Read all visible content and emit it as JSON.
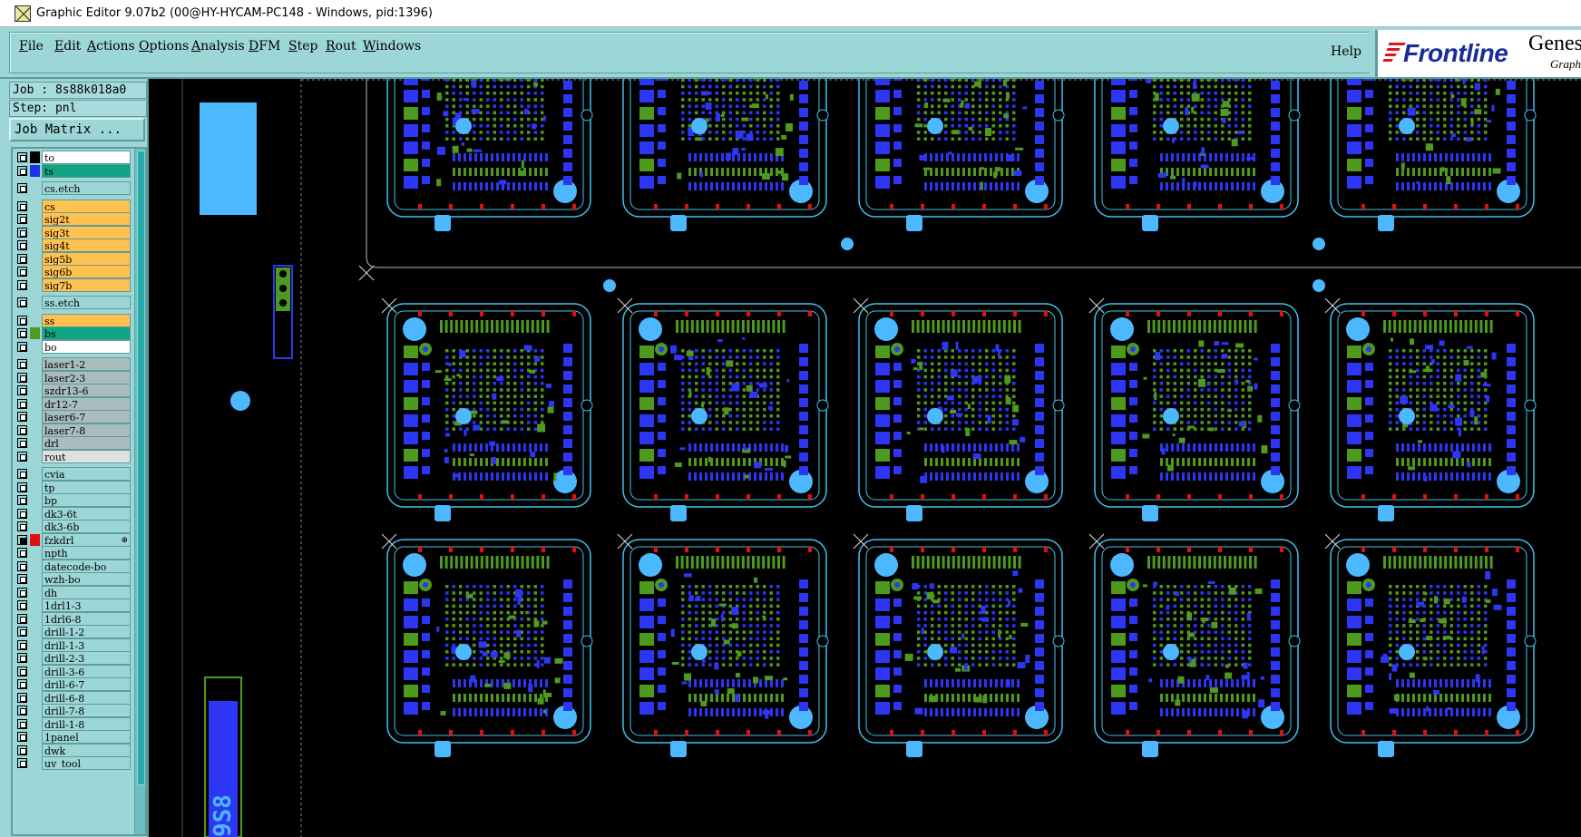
{
  "window": {
    "title": "Graphic Editor 9.07b2 (00@HY-HYCAM-PC148 - Windows, pid:1396)"
  },
  "menu": {
    "items": [
      "File",
      "Edit",
      "Actions",
      "Options",
      "Analysis",
      "DFM",
      "Step",
      "Rout",
      "Windows"
    ],
    "mnemonics": [
      "F",
      "E",
      "A",
      "O",
      "A",
      "D",
      "S",
      "R",
      "W"
    ],
    "help": "Help"
  },
  "logo": {
    "brand": "Frontline",
    "product": "Genes",
    "subtitle": "Graph"
  },
  "job": {
    "job_line": "Job : 8s88k018a0",
    "step_line": "Step: pnl",
    "matrix_button": "Job Matrix ..."
  },
  "colors": {
    "panel_bg": "#9dd6d6",
    "outline": "#3ec3f0",
    "copper": "#2d36f5",
    "mask": "#4d9a1e",
    "pad_light": "#4cb8ff",
    "route_red": "#e01010"
  },
  "layers": [
    {
      "name": "to",
      "bg": "#ffffff",
      "swatch": "#000000",
      "on": false,
      "group": 0
    },
    {
      "name": "ts",
      "bg": "#0fa583",
      "swatch": "#1f34e8",
      "on": false,
      "group": 0
    },
    {
      "name": "cs.etch",
      "bg": "#9dd6d6",
      "swatch": "",
      "on": false,
      "group": 1
    },
    {
      "name": "cs",
      "bg": "#ffc14f",
      "swatch": "",
      "on": false,
      "group": 2
    },
    {
      "name": "sig2t",
      "bg": "#ffc14f",
      "swatch": "",
      "on": false,
      "group": 2
    },
    {
      "name": "sig3t",
      "bg": "#ffc14f",
      "swatch": "",
      "on": false,
      "group": 2
    },
    {
      "name": "sig4t",
      "bg": "#ffc14f",
      "swatch": "",
      "on": false,
      "group": 2
    },
    {
      "name": "sig5b",
      "bg": "#ffc14f",
      "swatch": "",
      "on": false,
      "group": 2
    },
    {
      "name": "sig6b",
      "bg": "#ffc14f",
      "swatch": "",
      "on": false,
      "group": 2
    },
    {
      "name": "sig7b",
      "bg": "#ffc14f",
      "swatch": "",
      "on": false,
      "group": 2
    },
    {
      "name": "ss.etch",
      "bg": "#9dd6d6",
      "swatch": "",
      "on": false,
      "group": 3
    },
    {
      "name": "ss",
      "bg": "#ffc14f",
      "swatch": "",
      "on": false,
      "group": 4
    },
    {
      "name": "bs",
      "bg": "#0fa583",
      "swatch": "#4d9a1e",
      "on": false,
      "group": 4
    },
    {
      "name": "bo",
      "bg": "#ffffff",
      "swatch": "",
      "on": false,
      "group": 4
    },
    {
      "name": "laser1-2",
      "bg": "#a9bcbf",
      "swatch": "",
      "on": false,
      "group": 5
    },
    {
      "name": "laser2-3",
      "bg": "#a9bcbf",
      "swatch": "",
      "on": false,
      "group": 5
    },
    {
      "name": "szdr13-6",
      "bg": "#a9bcbf",
      "swatch": "",
      "on": false,
      "group": 5
    },
    {
      "name": "dr12-7",
      "bg": "#a9bcbf",
      "swatch": "",
      "on": false,
      "group": 5
    },
    {
      "name": "laser6-7",
      "bg": "#a9bcbf",
      "swatch": "",
      "on": false,
      "group": 5
    },
    {
      "name": "laser7-8",
      "bg": "#a9bcbf",
      "swatch": "",
      "on": false,
      "group": 5
    },
    {
      "name": "drl",
      "bg": "#a9bcbf",
      "swatch": "",
      "on": false,
      "group": 5
    },
    {
      "name": "rout",
      "bg": "#e0e0e0",
      "swatch": "",
      "on": false,
      "group": 5
    },
    {
      "name": "cvia",
      "bg": "#9dd6d6",
      "swatch": "",
      "on": false,
      "group": 6
    },
    {
      "name": "tp",
      "bg": "#9dd6d6",
      "swatch": "",
      "on": false,
      "group": 6
    },
    {
      "name": "bp",
      "bg": "#9dd6d6",
      "swatch": "",
      "on": false,
      "group": 6
    },
    {
      "name": "dk3-6t",
      "bg": "#9dd6d6",
      "swatch": "",
      "on": false,
      "group": 6
    },
    {
      "name": "dk3-6b",
      "bg": "#9dd6d6",
      "swatch": "",
      "on": false,
      "group": 6
    },
    {
      "name": "fzkdrl",
      "bg": "#9dd6d6",
      "swatch": "#e01010",
      "on": true,
      "group": 6,
      "mark": "⊕"
    },
    {
      "name": "npth",
      "bg": "#9dd6d6",
      "swatch": "",
      "on": false,
      "group": 6
    },
    {
      "name": "datecode-bo",
      "bg": "#9dd6d6",
      "swatch": "",
      "on": false,
      "group": 6
    },
    {
      "name": "wzh-bo",
      "bg": "#9dd6d6",
      "swatch": "",
      "on": false,
      "group": 6
    },
    {
      "name": "dh",
      "bg": "#9dd6d6",
      "swatch": "",
      "on": false,
      "group": 6
    },
    {
      "name": "1drl1-3",
      "bg": "#9dd6d6",
      "swatch": "",
      "on": false,
      "group": 6
    },
    {
      "name": "1drl6-8",
      "bg": "#9dd6d6",
      "swatch": "",
      "on": false,
      "group": 6
    },
    {
      "name": "drill-1-2",
      "bg": "#9dd6d6",
      "swatch": "",
      "on": false,
      "group": 6
    },
    {
      "name": "drill-1-3",
      "bg": "#9dd6d6",
      "swatch": "",
      "on": false,
      "group": 6
    },
    {
      "name": "drill-2-3",
      "bg": "#9dd6d6",
      "swatch": "",
      "on": false,
      "group": 6
    },
    {
      "name": "drill-3-6",
      "bg": "#9dd6d6",
      "swatch": "",
      "on": false,
      "group": 6
    },
    {
      "name": "drill-6-7",
      "bg": "#9dd6d6",
      "swatch": "",
      "on": false,
      "group": 6
    },
    {
      "name": "drill-6-8",
      "bg": "#9dd6d6",
      "swatch": "",
      "on": false,
      "group": 6
    },
    {
      "name": "drill-7-8",
      "bg": "#9dd6d6",
      "swatch": "",
      "on": false,
      "group": 6
    },
    {
      "name": "drill-1-8",
      "bg": "#9dd6d6",
      "swatch": "",
      "on": false,
      "group": 6
    },
    {
      "name": "1panel",
      "bg": "#9dd6d6",
      "swatch": "",
      "on": false,
      "group": 6
    },
    {
      "name": "dwk",
      "bg": "#9dd6d6",
      "swatch": "",
      "on": false,
      "group": 6
    },
    {
      "name": "uv_tool",
      "bg": "#9dd6d6",
      "swatch": "",
      "on": false,
      "group": 6
    }
  ],
  "canvas": {
    "columns": 5,
    "rows": 3,
    "datecode_text": "9S8"
  }
}
